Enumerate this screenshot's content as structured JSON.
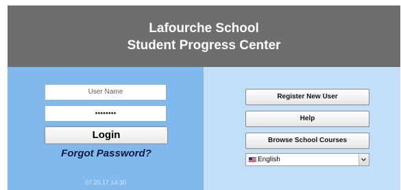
{
  "header": {
    "line1": "Lafourche School",
    "line2": "Student Progress Center"
  },
  "login": {
    "username_placeholder": "User Name",
    "password_value": "••••••••",
    "login_label": "Login",
    "forgot_label": "Forgot Password?",
    "timestamp": "07.20.17 14:30"
  },
  "actions": {
    "register_label": "Register New User",
    "help_label": "Help",
    "browse_label": "Browse School Courses"
  },
  "language": {
    "selected": "English",
    "flag_icon": "us-flag-icon"
  },
  "colors": {
    "header_bg": "#706e6d",
    "left_panel": "#7fb9ee",
    "right_panel": "#c2dff9"
  }
}
